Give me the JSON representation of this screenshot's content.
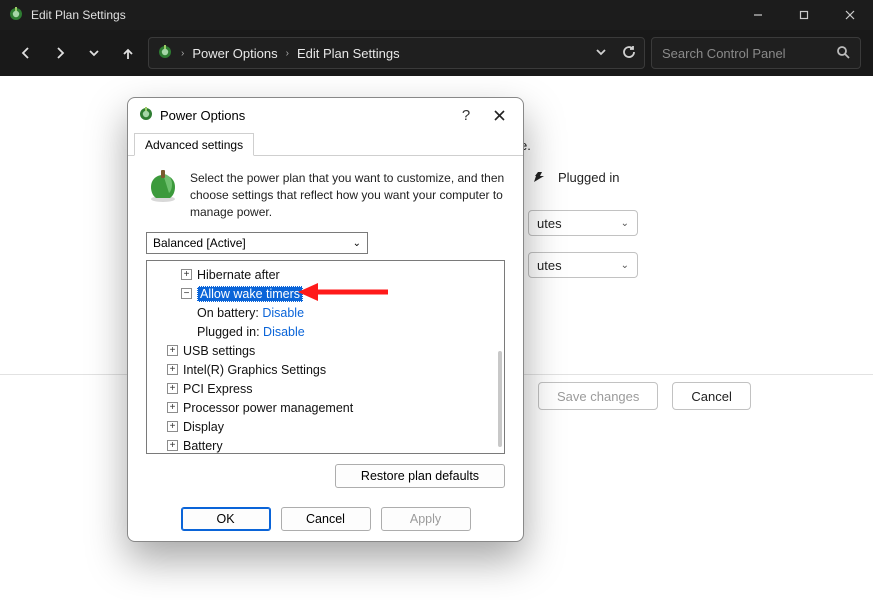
{
  "window": {
    "title": "Edit Plan Settings"
  },
  "nav": {
    "crumb1": "Power Options",
    "crumb2": "Edit Plan Settings",
    "search_placeholder": "Search Control Panel"
  },
  "page": {
    "plugged_in": "Plugged in",
    "unit_suffix": "utes",
    "save": "Save changes",
    "cancel": "Cancel",
    "hint_tail": "e."
  },
  "dialog": {
    "title": "Power Options",
    "tab": "Advanced settings",
    "intro": "Select the power plan that you want to customize, and then choose settings that reflect how you want your computer to manage power.",
    "plan": "Balanced [Active]",
    "restore": "Restore plan defaults",
    "ok": "OK",
    "cancel": "Cancel",
    "apply": "Apply"
  },
  "tree": {
    "hibernate": "Hibernate after",
    "allow_wake": "Allow wake timers",
    "on_batt_label": "On battery:",
    "on_batt_val": "Disable",
    "plugged_label": "Plugged in:",
    "plugged_val": "Disable",
    "usb": "USB settings",
    "intel": "Intel(R) Graphics Settings",
    "pci": "PCI Express",
    "ppm": "Processor power management",
    "display": "Display",
    "battery": "Battery"
  }
}
